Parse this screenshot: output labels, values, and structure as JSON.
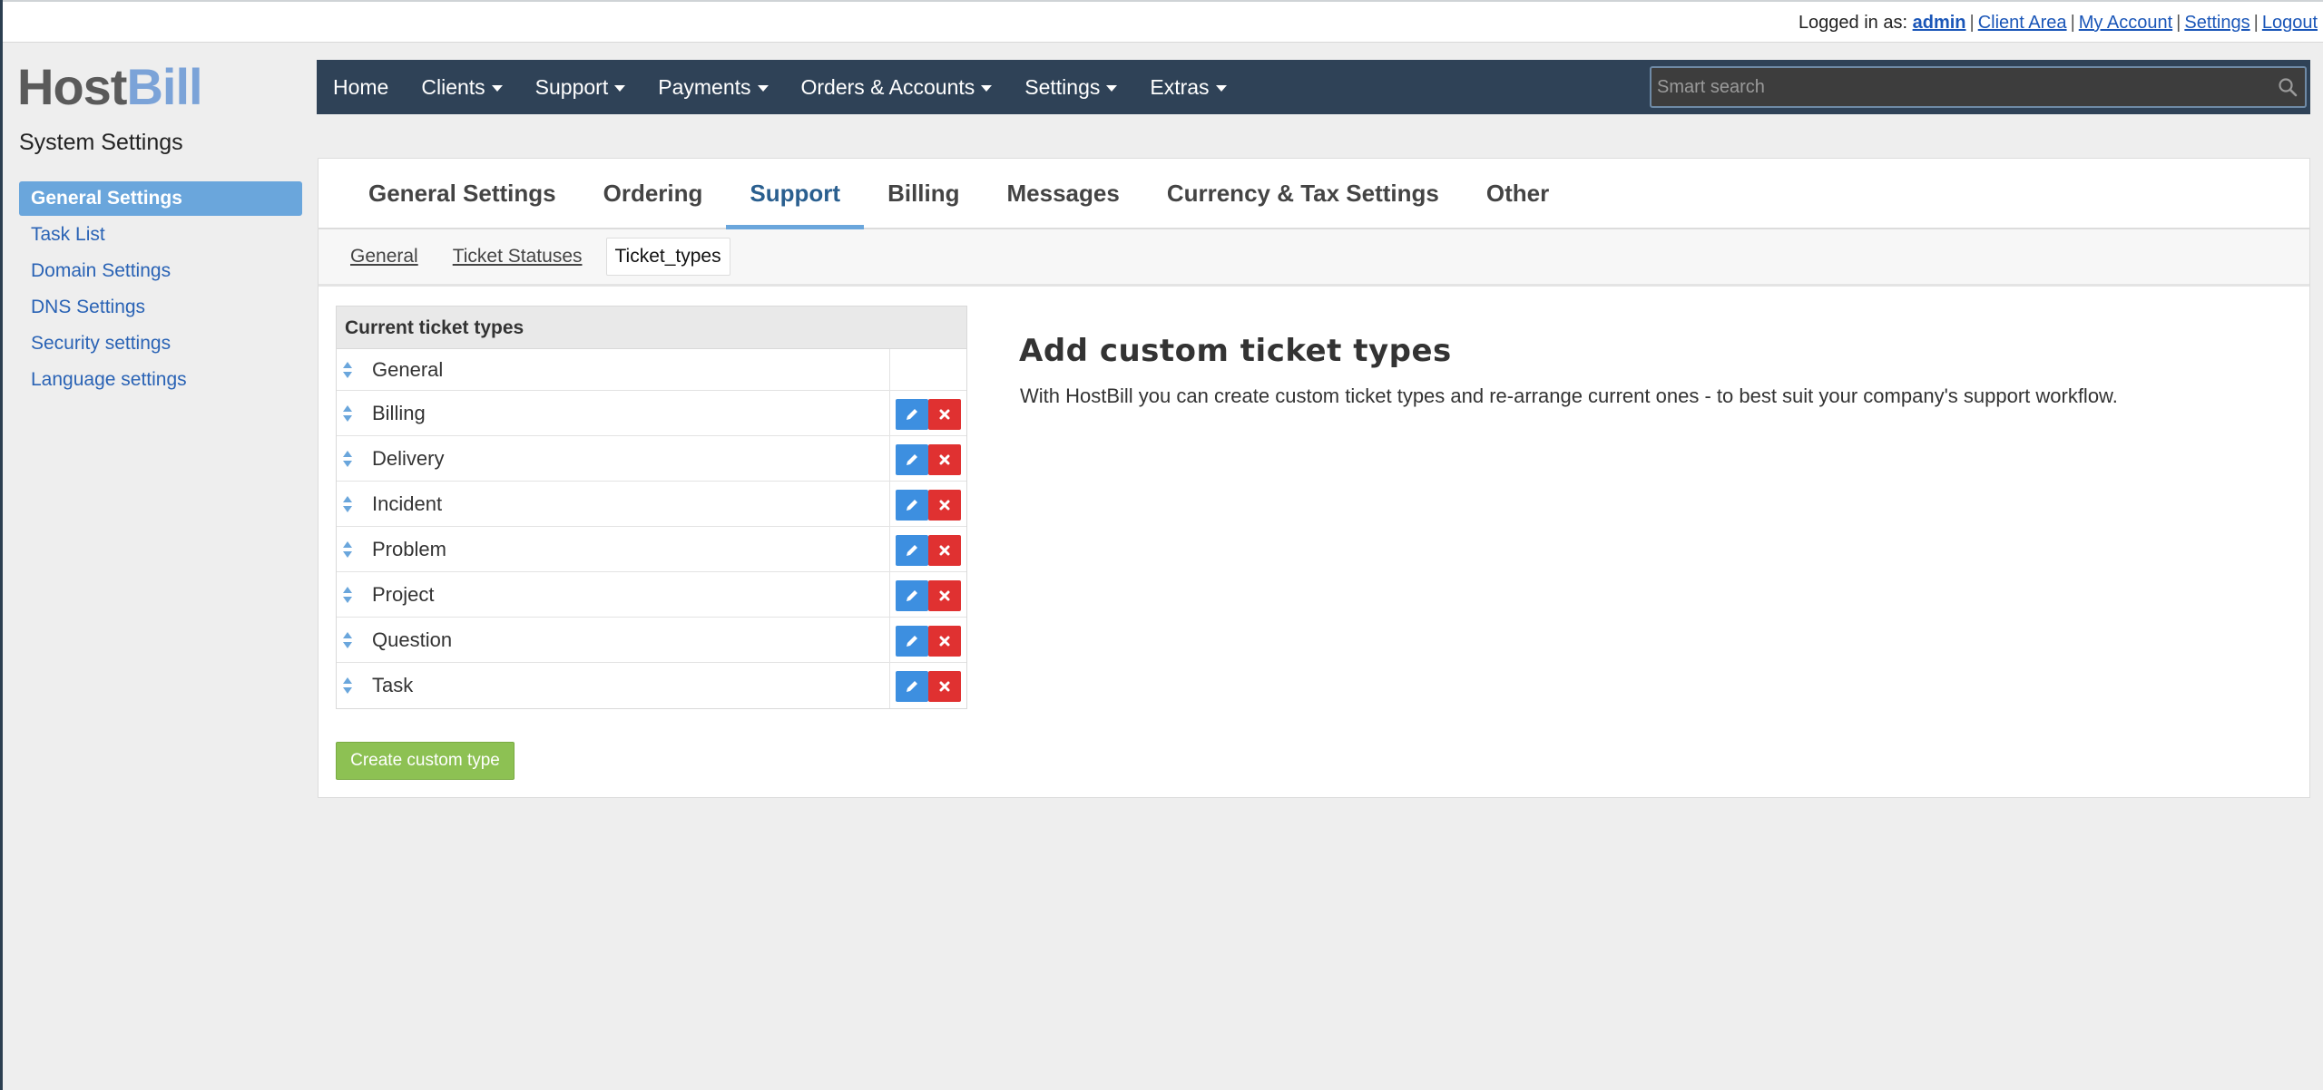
{
  "topbar": {
    "logged_in_as": "Logged in as:",
    "user": "admin",
    "links": [
      "Client Area",
      "My Account",
      "Settings",
      "Logout"
    ]
  },
  "sidebar": {
    "logo_host": "Host",
    "logo_bill": "Bill",
    "title": "System Settings",
    "items": [
      {
        "label": "General Settings",
        "active": true
      },
      {
        "label": "Task List"
      },
      {
        "label": "Domain Settings"
      },
      {
        "label": "DNS Settings"
      },
      {
        "label": "Security settings"
      },
      {
        "label": "Language settings"
      }
    ]
  },
  "navbar": {
    "items": [
      {
        "label": "Home",
        "dropdown": false
      },
      {
        "label": "Clients",
        "dropdown": true
      },
      {
        "label": "Support",
        "dropdown": true
      },
      {
        "label": "Payments",
        "dropdown": true
      },
      {
        "label": "Orders & Accounts",
        "dropdown": true
      },
      {
        "label": "Settings",
        "dropdown": true
      },
      {
        "label": "Extras",
        "dropdown": true
      }
    ],
    "search_placeholder": "Smart search"
  },
  "tabs": [
    {
      "label": "General Settings"
    },
    {
      "label": "Ordering"
    },
    {
      "label": "Support",
      "active": true
    },
    {
      "label": "Billing"
    },
    {
      "label": "Messages"
    },
    {
      "label": "Currency & Tax Settings"
    },
    {
      "label": "Other"
    }
  ],
  "subtabs": [
    {
      "label": "General"
    },
    {
      "label": "Ticket Statuses"
    },
    {
      "label": "Ticket_types",
      "active": true
    }
  ],
  "ticket_types": {
    "header": "Current ticket types",
    "rows": [
      "General",
      "Billing",
      "Delivery",
      "Incident",
      "Problem",
      "Project",
      "Question",
      "Task"
    ]
  },
  "create_button": "Create custom type",
  "info": {
    "title": "Add custom ticket types",
    "text": "With HostBill you can create custom ticket types and re-arrange current ones - to best suit your company's support workflow."
  },
  "colors": {
    "navbar": "#2f4257",
    "accent": "#6aa6dc",
    "edit": "#3d8fe0",
    "delete": "#e03131",
    "create": "#8dc153"
  }
}
